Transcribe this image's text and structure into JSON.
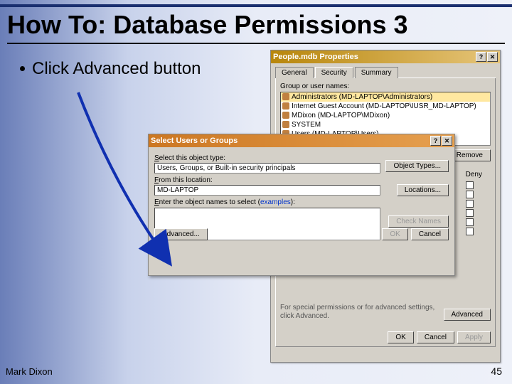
{
  "slide": {
    "title": "How To: Database Permissions 3",
    "bullet": "Click Advanced button",
    "footer_left": "Mark Dixon",
    "footer_right": "45"
  },
  "props": {
    "titlebar": "People.mdb Properties",
    "help_btn": "?",
    "close_btn": "✕",
    "tabs": {
      "general": "General",
      "security": "Security",
      "summary": "Summary"
    },
    "group_label": "Group or user names:",
    "users": [
      "Administrators (MD-LAPTOP\\Administrators)",
      "Internet Guest Account (MD-LAPTOP\\IUSR_MD-LAPTOP)",
      "MDixon (MD-LAPTOP\\MDixon)",
      "SYSTEM",
      "Users (MD-LAPTOP\\Users)"
    ],
    "remove_btn": "Remove",
    "deny_label": "Deny",
    "adv_hint": "For special permissions or for advanced settings, click Advanced.",
    "advanced_btn": "Advanced",
    "ok_btn": "OK",
    "cancel_btn": "Cancel",
    "apply_btn": "Apply"
  },
  "select": {
    "titlebar": "Select Users or Groups",
    "help_btn": "?",
    "close_btn": "✕",
    "object_type_label": "Select this object type:",
    "object_type_value": "Users, Groups, or Built-in security principals",
    "object_types_btn": "Object Types...",
    "location_label": "From this location:",
    "location_value": "MD-LAPTOP",
    "locations_btn": "Locations...",
    "names_label_pre": "Enter the object names to select (",
    "names_label_link": "examples",
    "names_label_post": "):",
    "check_names_btn": "Check Names",
    "advanced_btn": "Advanced...",
    "ok_btn": "OK",
    "cancel_btn": "Cancel"
  }
}
